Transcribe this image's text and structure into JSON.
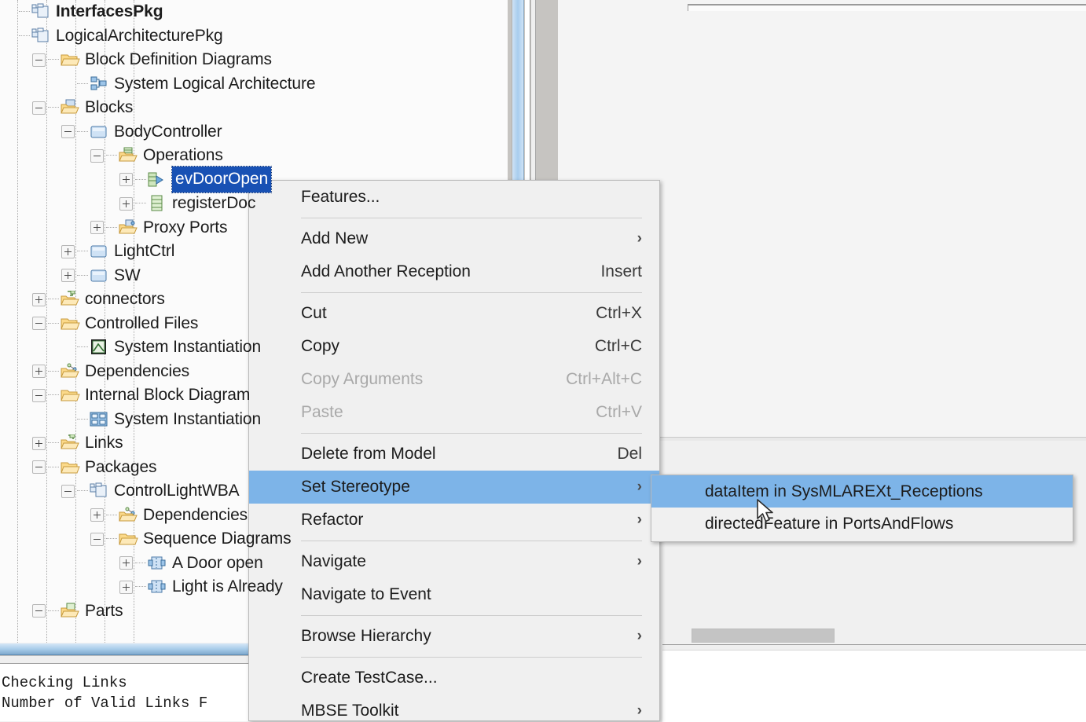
{
  "app": {
    "console_lines": [
      "Checking Links",
      "Number of Valid Links F"
    ]
  },
  "tree": {
    "items": [
      {
        "label": "InterfacesPkg",
        "icon": "package-icon",
        "indent": 0,
        "expander": "none",
        "bold": true,
        "selected": false
      },
      {
        "label": "LogicalArchitecturePkg",
        "icon": "package-icon",
        "indent": 0,
        "expander": "none",
        "bold": false,
        "selected": false
      },
      {
        "label": "Block Definition Diagrams",
        "icon": "folder-open-icon",
        "indent": 1,
        "expander": "minus",
        "bold": false,
        "selected": false
      },
      {
        "label": "System Logical Architecture",
        "icon": "bdd-icon",
        "indent": 2,
        "expander": "none",
        "bold": false,
        "selected": false
      },
      {
        "label": "Blocks",
        "icon": "folder-blocks-icon",
        "indent": 1,
        "expander": "minus",
        "bold": false,
        "selected": false
      },
      {
        "label": "BodyController",
        "icon": "block-icon",
        "indent": 2,
        "expander": "minus",
        "bold": false,
        "selected": false
      },
      {
        "label": "Operations",
        "icon": "folder-operations-icon",
        "indent": 3,
        "expander": "minus",
        "bold": false,
        "selected": false
      },
      {
        "label": "evDoorOpen",
        "icon": "reception-icon",
        "indent": 4,
        "expander": "plus",
        "bold": false,
        "selected": true
      },
      {
        "label": "registerDoc",
        "icon": "operation-icon",
        "indent": 4,
        "expander": "plus",
        "bold": false,
        "selected": false
      },
      {
        "label": "Proxy Ports",
        "icon": "folder-ports-icon",
        "indent": 3,
        "expander": "plus",
        "bold": false,
        "selected": false
      },
      {
        "label": "LightCtrl",
        "icon": "block-icon",
        "indent": 2,
        "expander": "plus",
        "bold": false,
        "selected": false
      },
      {
        "label": "SW",
        "icon": "block-icon",
        "indent": 2,
        "expander": "plus",
        "bold": false,
        "selected": false
      },
      {
        "label": "connectors",
        "icon": "folder-connectors-icon",
        "indent": 1,
        "expander": "plus",
        "bold": false,
        "selected": false
      },
      {
        "label": "Controlled Files",
        "icon": "folder-open-icon",
        "indent": 1,
        "expander": "minus",
        "bold": false,
        "selected": false
      },
      {
        "label": "System Instantiation",
        "icon": "controlled-file-icon",
        "indent": 2,
        "expander": "none",
        "bold": false,
        "selected": false
      },
      {
        "label": "Dependencies",
        "icon": "folder-dependencies-icon",
        "indent": 1,
        "expander": "plus",
        "bold": false,
        "selected": false
      },
      {
        "label": "Internal Block Diagram",
        "icon": "folder-open-icon",
        "indent": 1,
        "expander": "minus",
        "bold": false,
        "selected": false
      },
      {
        "label": "System Instantiation",
        "icon": "ibd-icon",
        "indent": 2,
        "expander": "none",
        "bold": false,
        "selected": false
      },
      {
        "label": "Links",
        "icon": "folder-links-icon",
        "indent": 1,
        "expander": "plus",
        "bold": false,
        "selected": false
      },
      {
        "label": "Packages",
        "icon": "folder-open-icon",
        "indent": 1,
        "expander": "minus",
        "bold": false,
        "selected": false
      },
      {
        "label": "ControlLightWBA",
        "icon": "package-icon",
        "indent": 2,
        "expander": "minus",
        "bold": false,
        "selected": false
      },
      {
        "label": "Dependencies",
        "icon": "folder-dependencies-icon",
        "indent": 3,
        "expander": "plus",
        "bold": false,
        "selected": false
      },
      {
        "label": "Sequence Diagrams",
        "icon": "folder-open-icon",
        "indent": 3,
        "expander": "minus",
        "bold": false,
        "selected": false
      },
      {
        "label": "A Door open",
        "icon": "sequence-diagram-icon",
        "indent": 4,
        "expander": "plus",
        "bold": false,
        "selected": false
      },
      {
        "label": "Light is Already",
        "icon": "sequence-diagram-icon",
        "indent": 4,
        "expander": "plus",
        "bold": false,
        "selected": false
      },
      {
        "label": "Parts",
        "icon": "folder-parts-icon",
        "indent": 1,
        "expander": "minus",
        "bold": false,
        "selected": false
      }
    ]
  },
  "context_menu": {
    "items": [
      {
        "label": "Features...",
        "shortcut": "",
        "submenu": false,
        "disabled": false,
        "highlighted": false,
        "separator_after": true
      },
      {
        "label": "Add New",
        "shortcut": "",
        "submenu": true,
        "disabled": false,
        "highlighted": false,
        "separator_after": false
      },
      {
        "label": "Add Another Reception",
        "shortcut": "Insert",
        "submenu": false,
        "disabled": false,
        "highlighted": false,
        "separator_after": true
      },
      {
        "label": "Cut",
        "shortcut": "Ctrl+X",
        "submenu": false,
        "disabled": false,
        "highlighted": false,
        "separator_after": false
      },
      {
        "label": "Copy",
        "shortcut": "Ctrl+C",
        "submenu": false,
        "disabled": false,
        "highlighted": false,
        "separator_after": false
      },
      {
        "label": "Copy Arguments",
        "shortcut": "Ctrl+Alt+C",
        "submenu": false,
        "disabled": true,
        "highlighted": false,
        "separator_after": false
      },
      {
        "label": "Paste",
        "shortcut": "Ctrl+V",
        "submenu": false,
        "disabled": true,
        "highlighted": false,
        "separator_after": true
      },
      {
        "label": "Delete from Model",
        "shortcut": "Del",
        "submenu": false,
        "disabled": false,
        "highlighted": false,
        "separator_after": false
      },
      {
        "label": "Set Stereotype",
        "shortcut": "",
        "submenu": true,
        "disabled": false,
        "highlighted": true,
        "separator_after": false
      },
      {
        "label": "Refactor",
        "shortcut": "",
        "submenu": true,
        "disabled": false,
        "highlighted": false,
        "separator_after": true
      },
      {
        "label": "Navigate",
        "shortcut": "",
        "submenu": true,
        "disabled": false,
        "highlighted": false,
        "separator_after": false
      },
      {
        "label": "Navigate to Event",
        "shortcut": "",
        "submenu": false,
        "disabled": false,
        "highlighted": false,
        "separator_after": true
      },
      {
        "label": "Browse Hierarchy",
        "shortcut": "",
        "submenu": true,
        "disabled": false,
        "highlighted": false,
        "separator_after": true
      },
      {
        "label": "Create TestCase...",
        "shortcut": "",
        "submenu": false,
        "disabled": false,
        "highlighted": false,
        "separator_after": false
      },
      {
        "label": "MBSE Toolkit",
        "shortcut": "",
        "submenu": true,
        "disabled": false,
        "highlighted": false,
        "separator_after": false
      }
    ]
  },
  "submenu": {
    "items": [
      {
        "label": "dataItem in SysMLAREXt_Receptions",
        "highlighted": true
      },
      {
        "label": "directedFeature in PortsAndFlows",
        "highlighted": false
      }
    ]
  },
  "colors": {
    "menu_bg": "#f0f0f0",
    "highlight": "#7db4e8",
    "selection": "#1851b4",
    "scrollbar_blue": "#a9cdea"
  }
}
